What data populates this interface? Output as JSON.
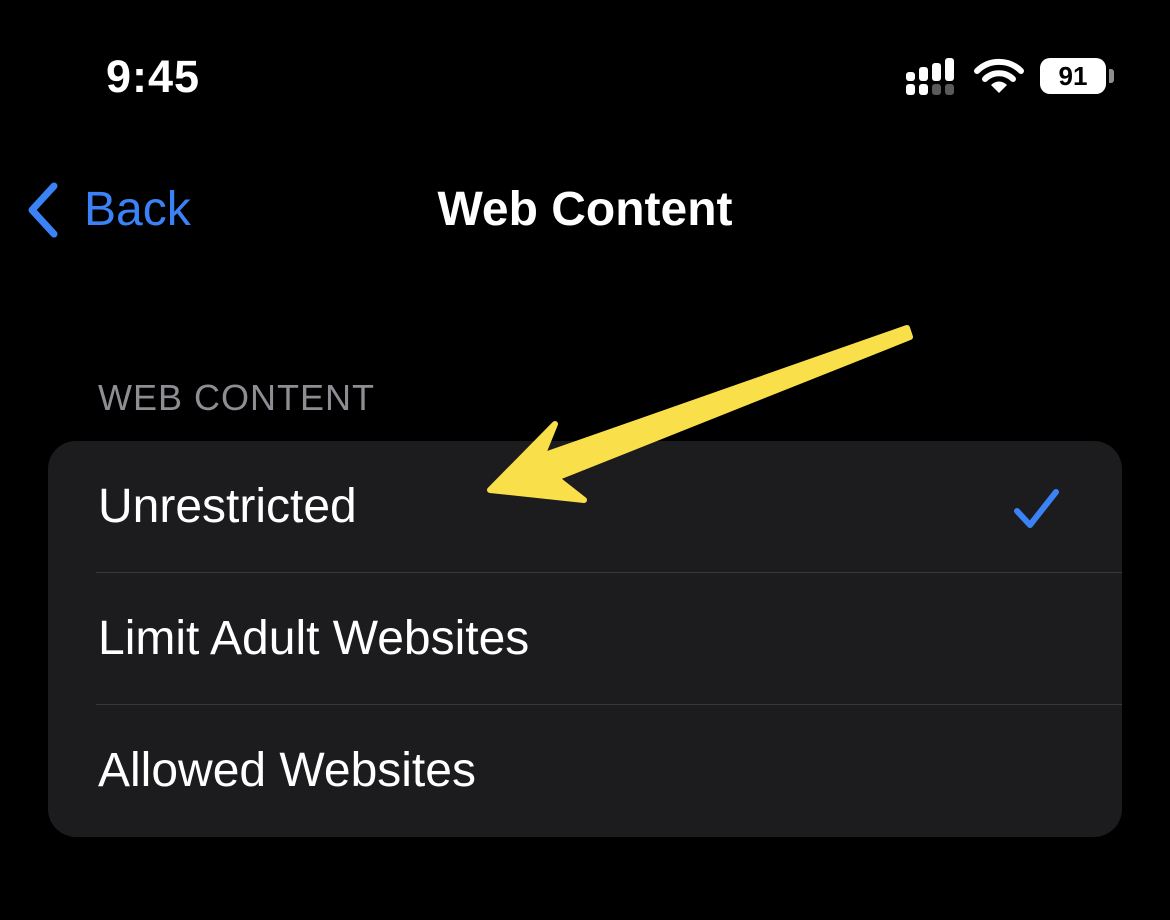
{
  "status_bar": {
    "time": "9:45",
    "signal_icon": "cellular-signal-icon",
    "wifi_icon": "wifi-icon",
    "battery_level": "91"
  },
  "nav": {
    "back_icon": "chevron-left-icon",
    "back_label": "Back",
    "title": "Web Content"
  },
  "section": {
    "header": "WEB CONTENT",
    "options": [
      {
        "label": "Unrestricted",
        "selected": true
      },
      {
        "label": "Limit Adult Websites",
        "selected": false
      },
      {
        "label": "Allowed Websites",
        "selected": false
      }
    ]
  },
  "annotation": {
    "type": "arrow",
    "color": "#f9e04b"
  },
  "colors": {
    "background": "#000000",
    "group_background": "#1c1c1e",
    "accent": "#3b82f6",
    "section_header": "#8d8d93",
    "separator": "#38383a"
  }
}
